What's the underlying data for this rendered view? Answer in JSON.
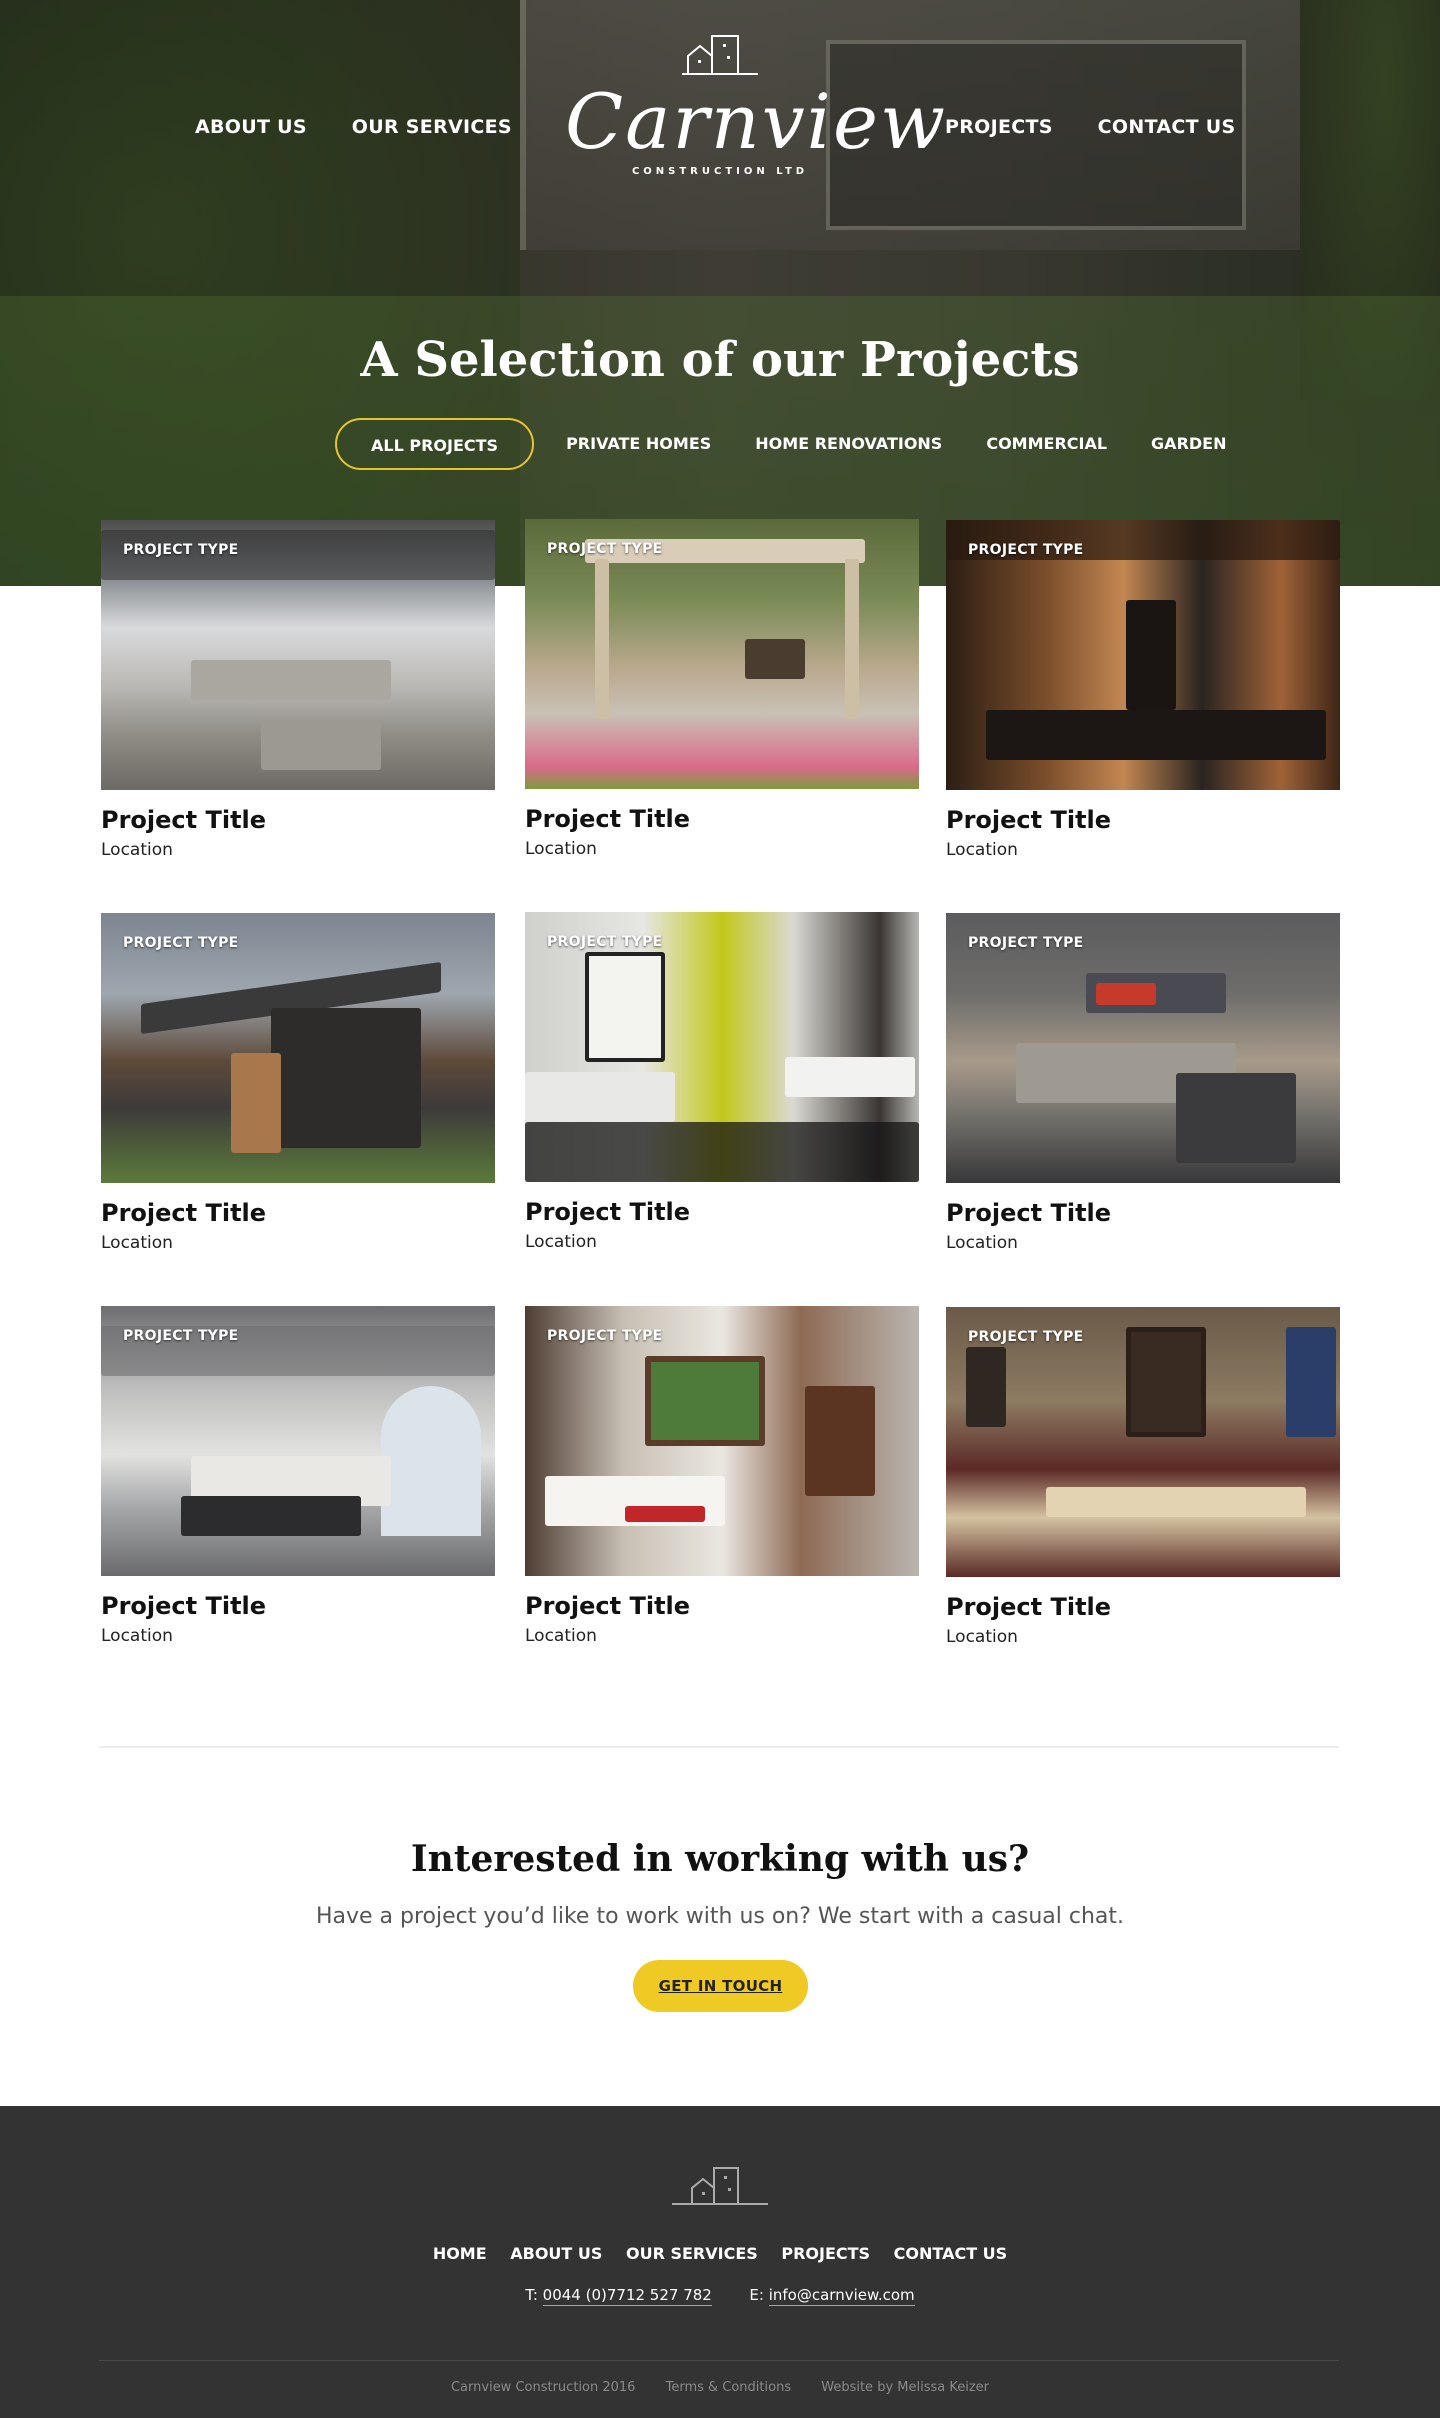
{
  "header": {
    "nav_left": [
      "ABOUT US",
      "OUR SERVICES"
    ],
    "nav_right": [
      "PROJECTS",
      "CONTACT US"
    ],
    "logo_text": "Carnview",
    "logo_sub": "CONSTRUCTION LTD"
  },
  "hero": {
    "title": "A Selection of our Projects",
    "filters": [
      "ALL PROJECTS",
      "PRIVATE HOMES",
      "HOME RENOVATIONS",
      "COMMERCIAL",
      "GARDEN"
    ],
    "active_filter": "ALL PROJECTS"
  },
  "projects": [
    {
      "type": "PROJECT TYPE",
      "title": "Project Title",
      "location": "Location",
      "image": "conservatory-living-room"
    },
    {
      "type": "PROJECT TYPE",
      "title": "Project Title",
      "location": "Location",
      "image": "garden-pergola-patio"
    },
    {
      "type": "PROJECT TYPE",
      "title": "Project Title",
      "location": "Location",
      "image": "modern-bar-interior"
    },
    {
      "type": "PROJECT TYPE",
      "title": "Project Title",
      "location": "Location",
      "image": "modern-house-exterior"
    },
    {
      "type": "PROJECT TYPE",
      "title": "Project Title",
      "location": "Location",
      "image": "living-room-yellow-wall"
    },
    {
      "type": "PROJECT TYPE",
      "title": "Project Title",
      "location": "Location",
      "image": "office-kitchen-lounge"
    },
    {
      "type": "PROJECT TYPE",
      "title": "Project Title",
      "location": "Location",
      "image": "office-meeting-room"
    },
    {
      "type": "PROJECT TYPE",
      "title": "Project Title",
      "location": "Location",
      "image": "lounge-with-tv-wall"
    },
    {
      "type": "PROJECT TYPE",
      "title": "Project Title",
      "location": "Location",
      "image": "restaurant-dining-room"
    }
  ],
  "cta": {
    "title": "Interested in working with us?",
    "subtitle": "Have a project you’d like to work with us on? We start with a casual chat.",
    "button": "GET IN TOUCH"
  },
  "footer": {
    "nav": [
      "HOME",
      "ABOUT US",
      "OUR SERVICES",
      "PROJECTS",
      "CONTACT US"
    ],
    "phone_label": "T:",
    "phone": "0044 (0)7712 527 782",
    "email_label": "E:",
    "email": "info@carnview.com",
    "copyright": "Carnview Construction 2016",
    "terms": "Terms & Conditions",
    "credit": "Website by Melissa Keizer"
  },
  "colors": {
    "accent": "#efc924",
    "footer_bg": "#333333",
    "hero_overlay": "#23231e"
  }
}
